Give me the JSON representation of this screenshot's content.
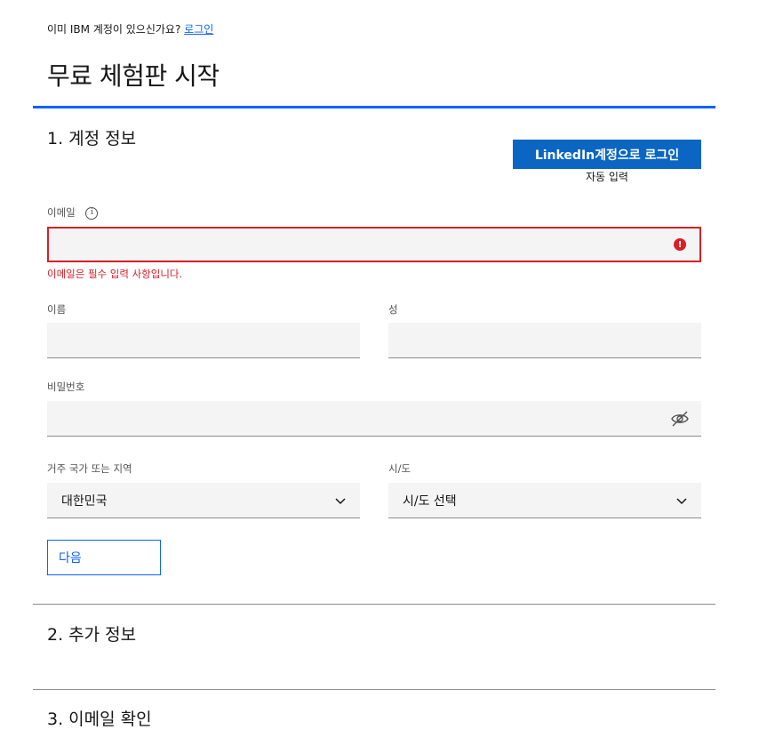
{
  "header": {
    "have_account_text": "이미 IBM 계정이 있으신가요?",
    "login_link": "로그인",
    "title": "무료 체험판 시작"
  },
  "section1": {
    "title": "1. 계정 정보",
    "linkedin_button": "LinkedIn계정으로 로그인",
    "autofill_text": "자동 입력",
    "email": {
      "label": "이메일",
      "value": "",
      "error_text": "이메일은 필수 입력 사항입니다."
    },
    "first_name": {
      "label": "이름",
      "value": ""
    },
    "last_name": {
      "label": "성",
      "value": ""
    },
    "password": {
      "label": "비밀번호",
      "value": ""
    },
    "country": {
      "label": "거주 국가 또는 지역",
      "selected": "대한민국"
    },
    "state": {
      "label": "시/도",
      "selected": "시/도 선택"
    },
    "next_button": "다음"
  },
  "section2": {
    "title": "2. 추가 정보"
  },
  "section3": {
    "title": "3. 이메일 확인"
  },
  "colors": {
    "accent": "#0f62fe",
    "linkedin": "#0a66c2",
    "error": "#da1e28",
    "field_bg": "#f4f4f4"
  }
}
